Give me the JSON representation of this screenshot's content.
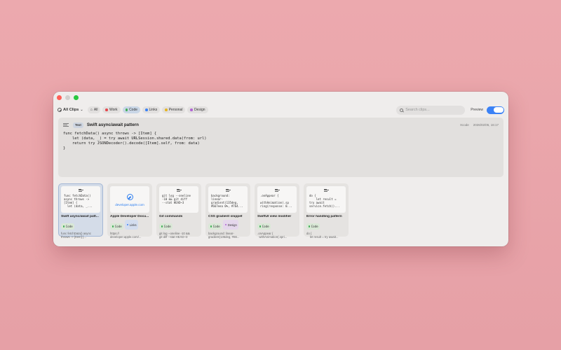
{
  "toolbar": {
    "all_clips": "All Clips",
    "filters": [
      {
        "label": "All",
        "color": "",
        "icon": "tag-icon"
      },
      {
        "label": "Work",
        "color": "#e5484d"
      },
      {
        "label": "Code",
        "color": "#3fae55",
        "active": true
      },
      {
        "label": "Links",
        "color": "#3b82f6"
      },
      {
        "label": "Personal",
        "color": "#e6b422"
      },
      {
        "label": "Design",
        "color": "#b266d4"
      }
    ],
    "search_placeholder": "Search clips...",
    "preview_label": "Preview",
    "preview_on": true
  },
  "detail": {
    "type": "Text",
    "title": "Swift async/await pattern",
    "source": "Xcode",
    "timestamp": "2026/02/05, 16:17",
    "code": "func fetchData() async throws -> [Item] {\n    let (data, _) = try await URLSession.shared.data(from: url)\n    return try JSONDecoder().decode([Item].self, from: data)\n}"
  },
  "cards": [
    {
      "title": "Swift async/await patt...",
      "preview": "func fetchData()\nasync throws ->\n[Item] {\n  let (data, _...",
      "tags": [
        {
          "label": "Code",
          "color": "#3fae55",
          "kind": "code"
        }
      ],
      "snippet": "func fetchData() async\nthrows -> [Item] {...",
      "selected": true
    },
    {
      "title": "Apple Developer Docu...",
      "link": true,
      "domain": "developer.apple.com",
      "tags": [
        {
          "label": "Code",
          "color": "#3fae55",
          "kind": "code"
        },
        {
          "label": "Links",
          "color": "#3b82f6",
          "kind": "links"
        }
      ],
      "snippet": "https://\ndeveloper.apple.com/..."
    },
    {
      "title": "Git commands",
      "preview": "git log --oneline\n-10 && git diff\n--stat HEAD~3",
      "tags": [
        {
          "label": "Code",
          "color": "#3fae55",
          "kind": "code"
        }
      ],
      "snippet": "git log --oneline -10 &&\ngit diff --stat HEAD~3"
    },
    {
      "title": "CSS gradient snippet",
      "preview": "background:\nlinear-\ngradient(135deg,\n#667eea 0%, #764...",
      "tags": [
        {
          "label": "Code",
          "color": "#3fae55",
          "kind": "code"
        },
        {
          "label": "Design",
          "color": "#b266d4",
          "kind": "design"
        }
      ],
      "snippet": "background: linear-\ngradient(135deg, #66..."
    },
    {
      "title": "SwiftUI view modifier",
      "preview": ".onAppear {\n\nwithAnimation(.sp\nring(response: 0...",
      "tags": [
        {
          "label": "Code",
          "color": "#3fae55",
          "kind": "code"
        }
      ],
      "snippet": ".onAppear {\n  withAnimation(.spri..."
    },
    {
      "title": "Error handling pattern",
      "preview": "do {\n    let result =\ntry await\nservice.fetch()...",
      "tags": [
        {
          "label": "Code",
          "color": "#3fae55",
          "kind": "code"
        }
      ],
      "snippet": "do {\n    let result = try await..."
    }
  ]
}
